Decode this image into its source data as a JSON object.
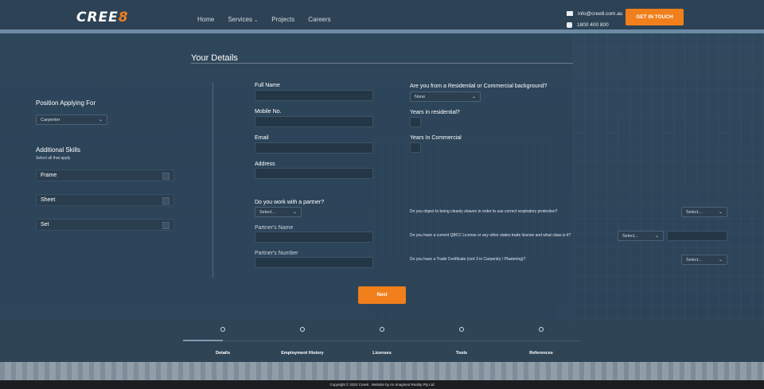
{
  "header": {
    "logo_prefix": "CREE",
    "logo_suffix": "8",
    "nav": [
      "Home",
      "Services",
      "Projects",
      "Careers"
    ],
    "email": "info@cree8.com.au",
    "phone": "1800 400 800",
    "cta": "GET IN TOUCH"
  },
  "section_title": "Your Details",
  "left": {
    "position_label": "Position Applying For",
    "position_value": "Carpenter",
    "skills_label": "Additional Skills",
    "skills_hint": "Select all that apply",
    "skills": [
      "Frame",
      "Sheet",
      "Set"
    ]
  },
  "form": {
    "full_name": "Full Name",
    "mobile": "Mobile No.",
    "email": "Email",
    "address": "Address",
    "partner_q": "Do you work with a partner?",
    "partner_select": "Select...",
    "partner_name": "Partner's Name",
    "partner_number": "Partner's Number",
    "background_q": "Are you from a Residential or Commercial background?",
    "background_select": "None",
    "years_res": "Years in residential?",
    "years_com": "Years In Commercial",
    "q_shaven": "Do you object to being cleanly shaven in order to use correct respiratory protection?",
    "q_shaven_select": "Select...",
    "q_qbcc": "Do you have a current QBCC License or any other states trade license and what class is it?",
    "q_qbcc_select": "Select...",
    "q_trade": "Do you have a Trade Certificate (cert 3 in Carpentry / Plastering)?",
    "q_trade_select": "Select...",
    "next": "Next"
  },
  "steps": [
    "Details",
    "Employment History",
    "Licenses",
    "Tools",
    "References"
  ],
  "footer": "Copyright © 2022 Cree8 . Website by An Imagined Reality Pty Ltd",
  "colors": {
    "accent": "#f07f1c",
    "header": "#2d4254"
  }
}
